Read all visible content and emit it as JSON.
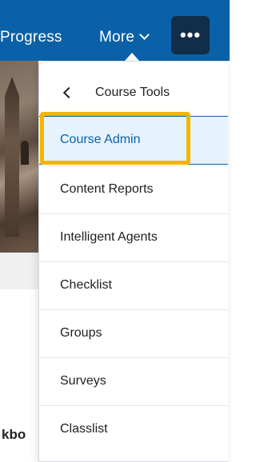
{
  "navbar": {
    "items": [
      {
        "label": "Progress"
      },
      {
        "label": "More"
      }
    ],
    "more_chevron_icon": "chevron-down-icon",
    "overflow_button": {
      "label": "•••",
      "icon": "more-horizontal-icon"
    },
    "color": "#0a61a7",
    "overflow_color": "#102d49"
  },
  "background": {
    "partial_text": "kbo"
  },
  "menu": {
    "back_icon": "chevron-left-icon",
    "title": "Course Tools",
    "items": [
      {
        "label": "Course Admin",
        "active": true
      },
      {
        "label": "Content Reports"
      },
      {
        "label": "Intelligent Agents"
      },
      {
        "label": "Checklist"
      },
      {
        "label": "Groups"
      },
      {
        "label": "Surveys"
      },
      {
        "label": "Classlist"
      }
    ],
    "highlight_color": "#f5b400",
    "active_bg": "#e6f3fd"
  }
}
